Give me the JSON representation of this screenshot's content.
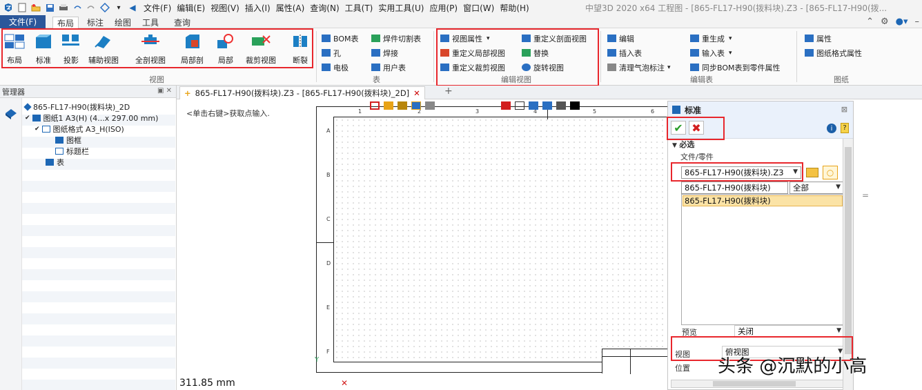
{
  "titlebar": {
    "menus": [
      "文件(F)",
      "编辑(E)",
      "视图(V)",
      "插入(I)",
      "属性(A)",
      "查询(N)",
      "工具(T)",
      "实用工具(U)",
      "应用(P)",
      "窗口(W)",
      "帮助(H)"
    ],
    "app_title": "中望3D 2020 x64      工程图 - [865-FL17-H90(拨料块).Z3 - [865-FL17-H90(拨..."
  },
  "tabs": {
    "file": "文件(F)",
    "items": [
      "布局",
      "标注",
      "绘图",
      "工具",
      "查询"
    ]
  },
  "ribbon": {
    "layout_group": {
      "label": "视图",
      "buttons": [
        "布局",
        "标准",
        "投影",
        "辅助视图",
        "全剖视图",
        "局部剖",
        "局部",
        "裁剪视图",
        "断裂"
      ]
    },
    "table_group": {
      "label": "表",
      "buttons": [
        "BOM表",
        "焊件切割表",
        "孔",
        "焊接",
        "电极",
        "用户表"
      ]
    },
    "edit_view_group": {
      "label": "编辑视图",
      "buttons": [
        "视图属性",
        "重定义剖面视图",
        "重定义局部视图",
        "替换",
        "重定义裁剪视图",
        "旋转视图"
      ]
    },
    "edit_table_group": {
      "label": "编辑表",
      "buttons": [
        "编辑",
        "重生成",
        "插入表",
        "输入表",
        "清理气泡标注",
        "同步BOM表到零件属性"
      ]
    },
    "sheet_group": {
      "label": "图纸",
      "buttons": [
        "属性",
        "图纸格式属性"
      ]
    }
  },
  "manager": {
    "title": "管理器",
    "tree": [
      "865-FL17-H90(拨料块)_2D",
      "图纸1 A3(H) (4...x 297.00 mm)",
      "图纸格式 A3_H(ISO)",
      "图框",
      "标题栏",
      "表"
    ]
  },
  "document": {
    "tab_label": "865-FL17-H90(拨料块).Z3 - [865-FL17-H90(拨料块)_2D]",
    "hint": "<单击右键>获取点输入.",
    "measure": "311.85 mm",
    "ruler_top": [
      "1",
      "2",
      "3",
      "4",
      "5",
      "6"
    ],
    "ruler_left": [
      "A",
      "B",
      "C",
      "D",
      "E",
      "F"
    ]
  },
  "property_panel": {
    "title": "标准",
    "required": "必选",
    "file_part_label": "文件/零件",
    "file_value": "865-FL17-H90(拨料块).Z3",
    "part_value": "865-FL17-H90(拨料块)",
    "filter_value": "全部",
    "selected_item": "865-FL17-H90(拨料块)",
    "preview_label": "预览",
    "preview_value": "关闭",
    "view_label": "视图",
    "view_value": "俯视图",
    "position_label": "位置"
  },
  "watermark": "头条 @沉默的小高",
  "colors": {
    "accent": "#2b579a",
    "highlight_box": "#e8262c",
    "selection": "#fbe3a6"
  }
}
